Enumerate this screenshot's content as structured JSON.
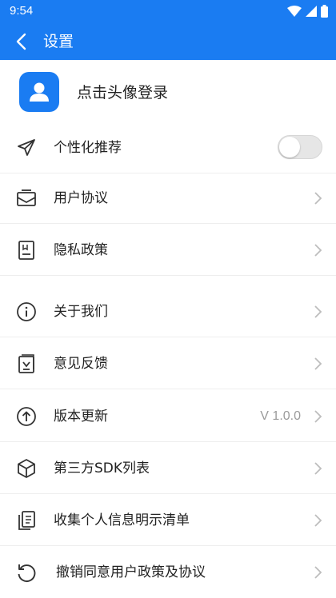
{
  "status_bar": {
    "time": "9:54"
  },
  "app_bar": {
    "title": "设置"
  },
  "profile": {
    "label": "点击头像登录"
  },
  "toggle_row": {
    "label": "个性化推荐",
    "enabled": false
  },
  "menu": {
    "user_agreement": "用户协议",
    "privacy_policy": "隐私政策",
    "about_us": "关于我们",
    "feedback": "意见反馈",
    "version_update": "版本更新",
    "version_value": "V 1.0.0",
    "third_party_sdk": "第三方SDK列表",
    "personal_info_list": "收集个人信息明示清单",
    "revoke_consent": "撤销同意用户政策及协议"
  },
  "colors": {
    "primary": "#1a7cf2",
    "divider": "#eeeeee",
    "chevron": "#bdbdbd",
    "muted_text": "#9a9a9a"
  }
}
